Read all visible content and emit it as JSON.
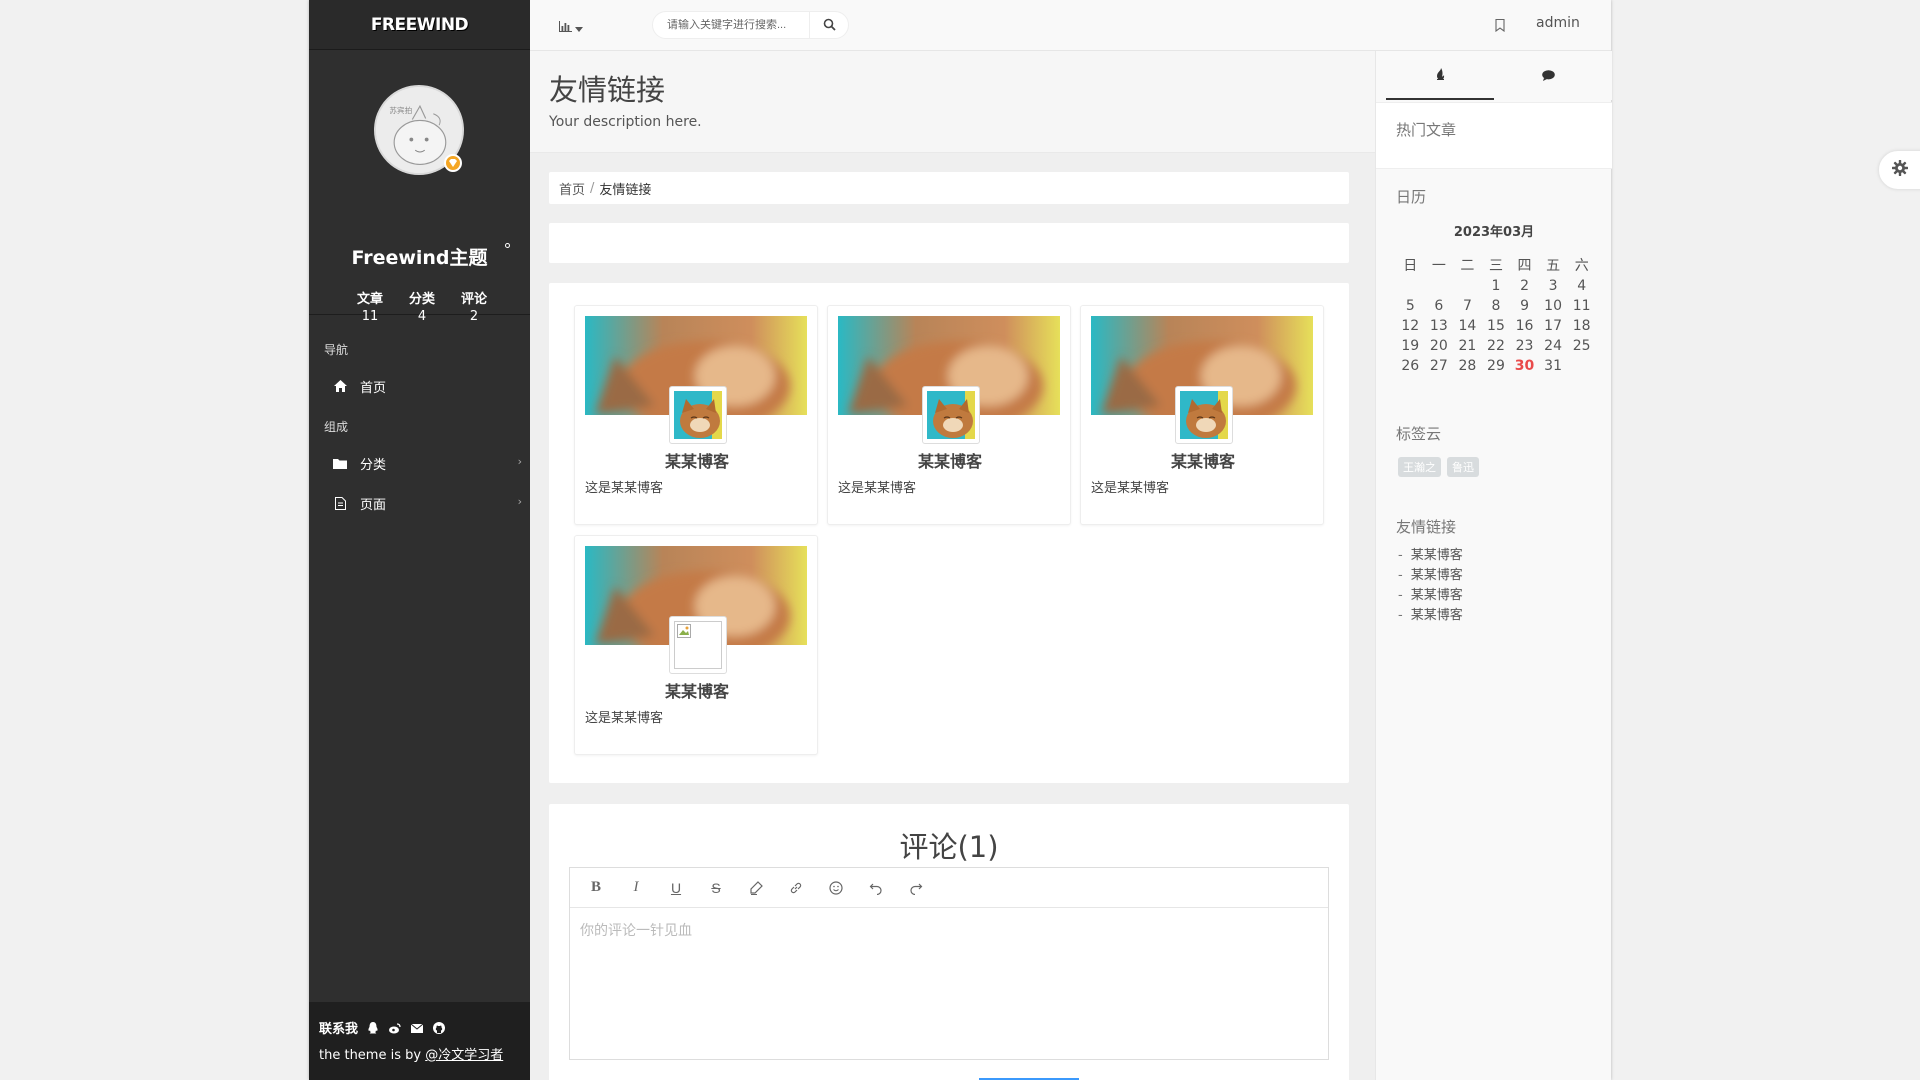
{
  "brand": {
    "logo_text": "FREEWIND"
  },
  "profile": {
    "avatar_caption": "苏宾拍",
    "site_name": "Freewind主题",
    "stats": [
      {
        "label": "文章",
        "value": "11"
      },
      {
        "label": "分类",
        "value": "4"
      },
      {
        "label": "评论",
        "value": "2"
      }
    ]
  },
  "nav": {
    "section_nav": "导航",
    "home": "首页",
    "section_compose": "组成",
    "category": "分类",
    "pages": "页面"
  },
  "footer": {
    "contact_label": "联系我",
    "credit_prefix": "the theme is by ",
    "credit_author": "@冷文学习者",
    "icons": [
      "qq-icon",
      "weibo-icon",
      "mail-icon",
      "github-icon"
    ]
  },
  "header": {
    "search_placeholder": "请输入关键字进行搜索...",
    "user": "admin"
  },
  "page": {
    "title": "友情链接",
    "description": "Your description here.",
    "breadcrumb": [
      "首页",
      "友情链接"
    ]
  },
  "friends": [
    {
      "name": "某某博客",
      "desc": "这是某某博客",
      "avatar": "cat"
    },
    {
      "name": "某某博客",
      "desc": "这是某某博客",
      "avatar": "cat"
    },
    {
      "name": "某某博客",
      "desc": "这是某某博客",
      "avatar": "cat"
    },
    {
      "name": "某某博客",
      "desc": "这是某某博客",
      "avatar": "broken"
    }
  ],
  "comments": {
    "title": "评论(1)",
    "placeholder": "你的评论一针见血",
    "toolbar": [
      "bold-icon",
      "italic-icon",
      "underline-icon",
      "strikethrough-icon",
      "highlight-icon",
      "link-icon",
      "emoji-icon",
      "undo-icon",
      "redo-icon"
    ]
  },
  "right": {
    "tabs": [
      "fire-icon",
      "comment-icon"
    ],
    "hot_title": "热门文章",
    "calendar_title": "日历",
    "calendar_month": "2023年03月",
    "weekdays": [
      "日",
      "一",
      "二",
      "三",
      "四",
      "五",
      "六"
    ],
    "weeks": [
      [
        "",
        "",
        "",
        "1",
        "2",
        "3",
        "4"
      ],
      [
        "5",
        "6",
        "7",
        "8",
        "9",
        "10",
        "11"
      ],
      [
        "12",
        "13",
        "14",
        "15",
        "16",
        "17",
        "18"
      ],
      [
        "19",
        "20",
        "21",
        "22",
        "23",
        "24",
        "25"
      ],
      [
        "26",
        "27",
        "28",
        "29",
        "30",
        "31",
        ""
      ]
    ],
    "today": "30",
    "tag_title": "标签云",
    "tags": [
      "王瀚之",
      "鲁迅"
    ],
    "links_title": "友情链接",
    "links": [
      "某某博客",
      "某某博客",
      "某某博客",
      "某某博客"
    ]
  },
  "colors": {
    "sidebar_bg": "#2f2f2f",
    "today": "#e94a4a",
    "vip_badge": "#f5a623",
    "submit_accent": "#3b99fc"
  }
}
